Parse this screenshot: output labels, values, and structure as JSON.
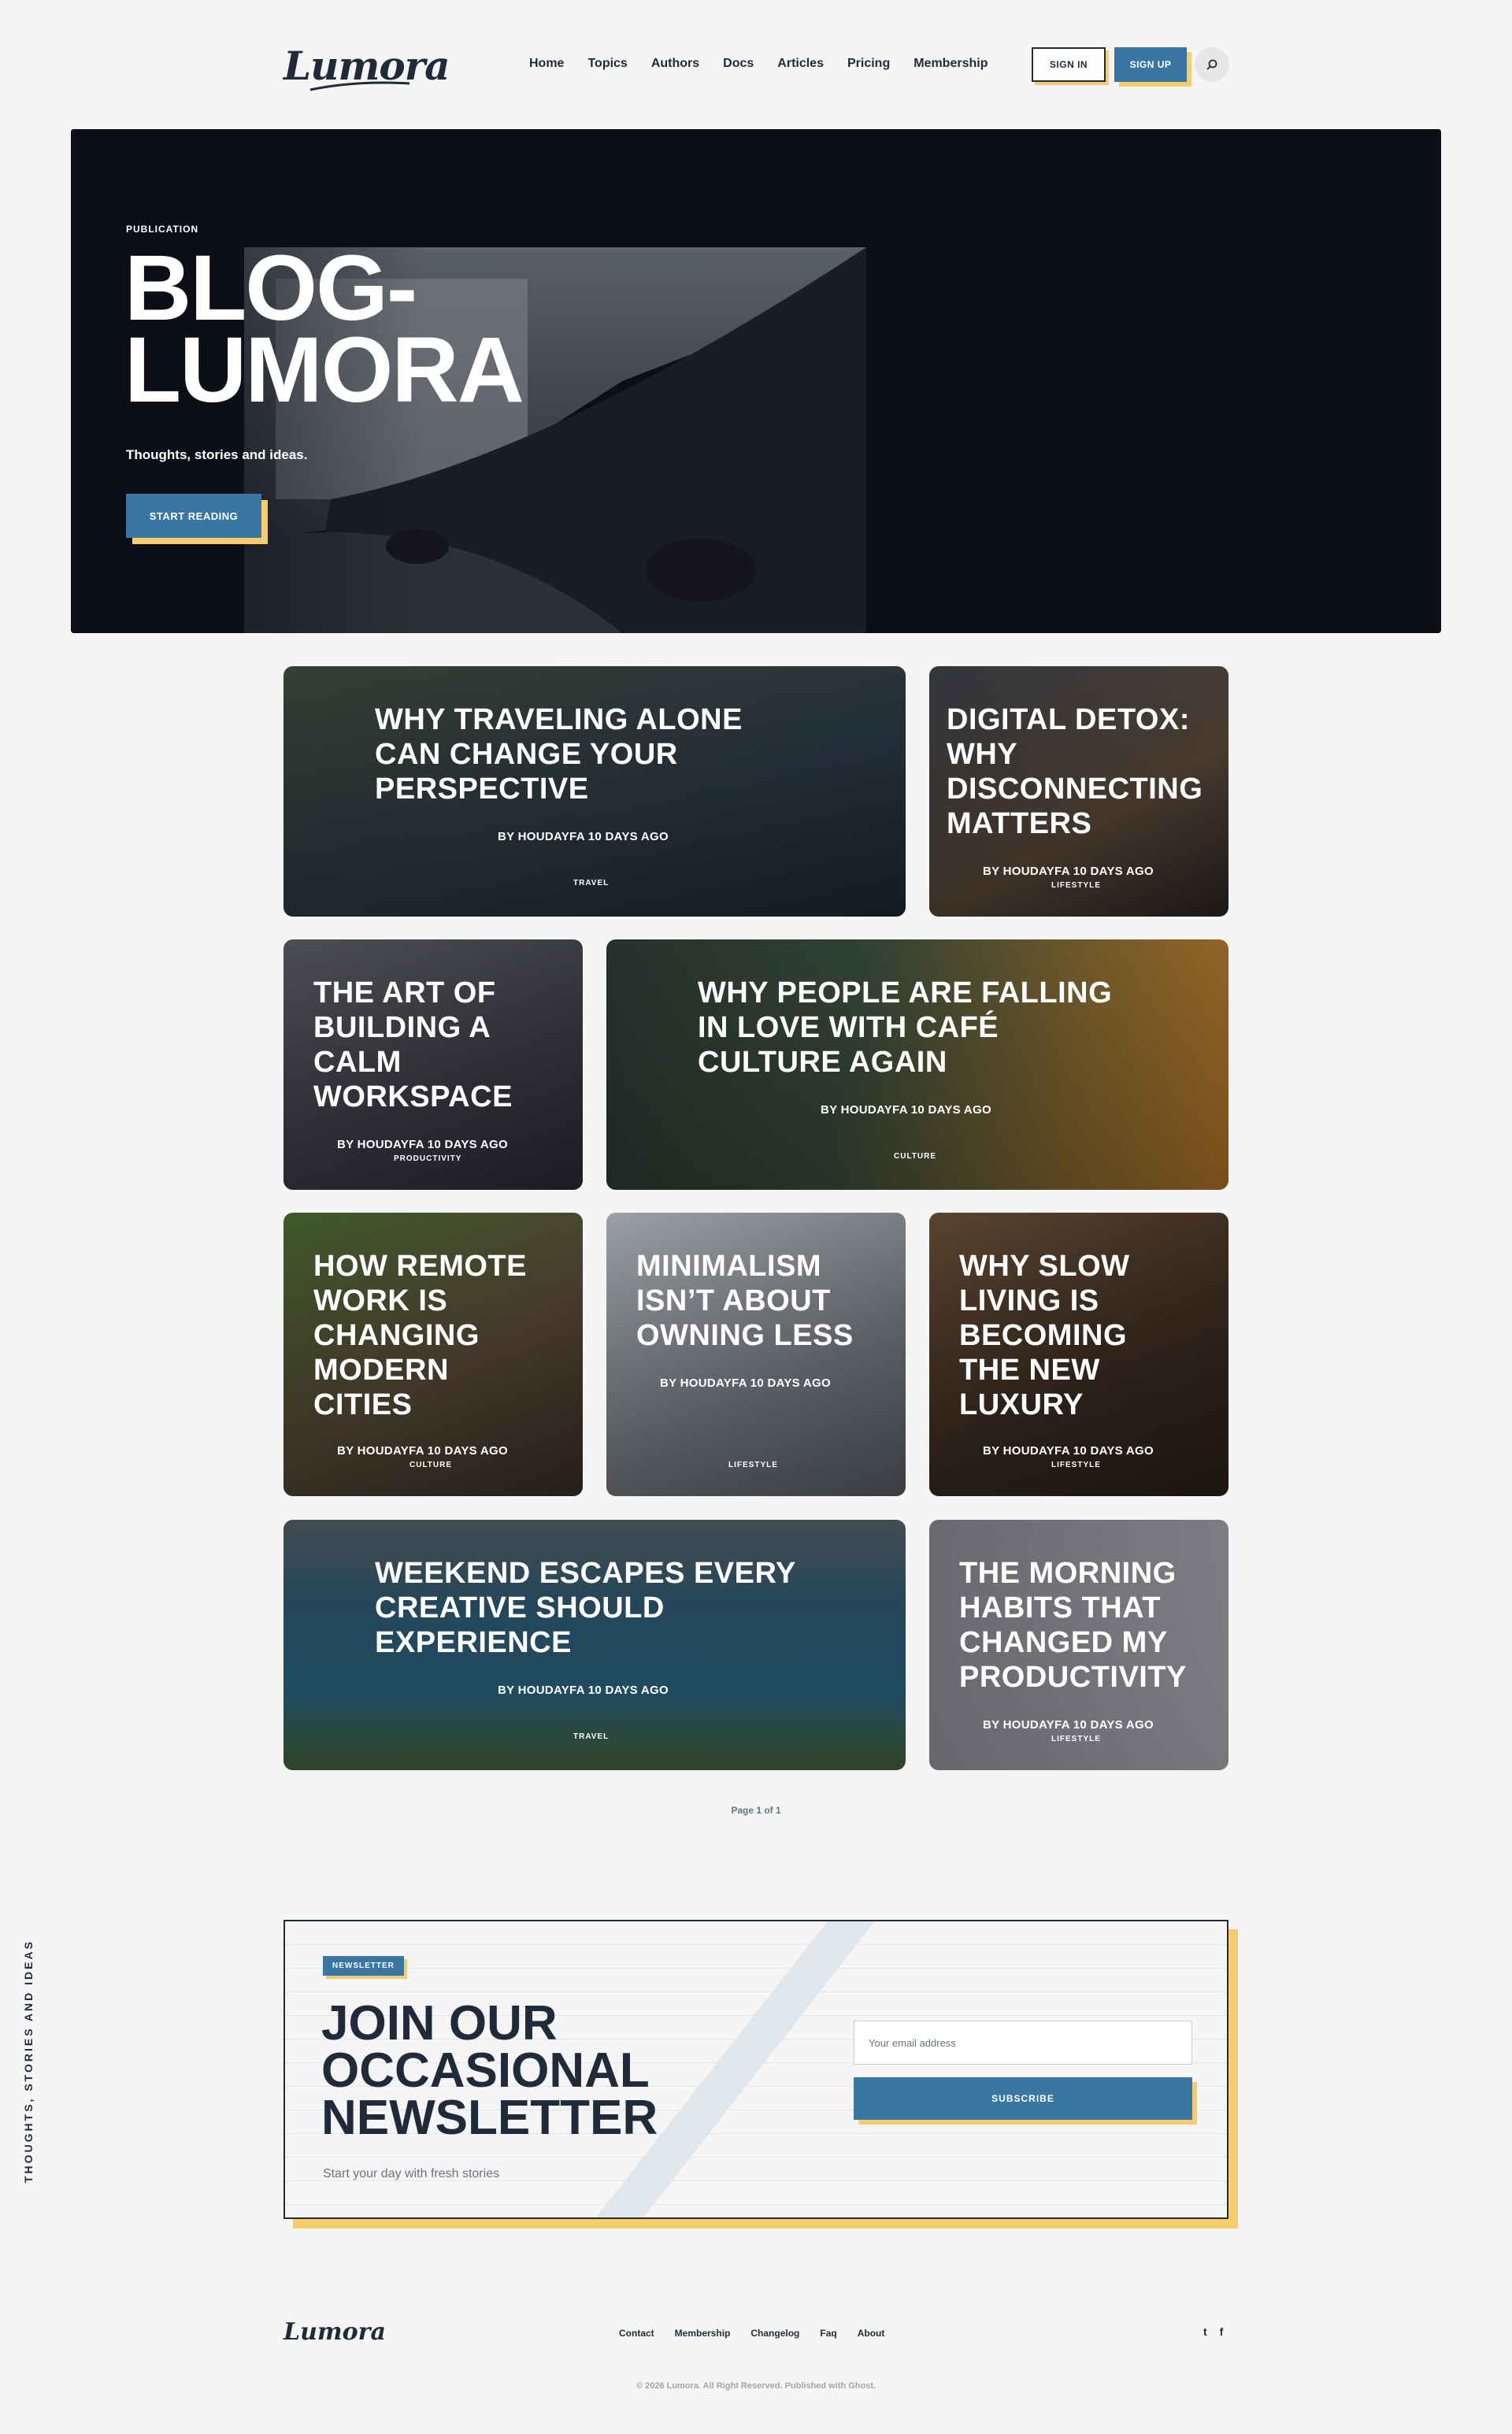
{
  "header": {
    "logo": "Lumora",
    "nav": [
      "Home",
      "Topics",
      "Authors",
      "Docs",
      "Articles",
      "Pricing",
      "Membership"
    ],
    "sign_in": "SIGN IN",
    "sign_up": "SIGN UP",
    "search_icon": "search-icon"
  },
  "hero": {
    "label": "PUBLICATION",
    "title": "BLOG-LUMORA",
    "subtitle": "Thoughts, stories and ideas.",
    "button": "START READING"
  },
  "posts": [
    {
      "title": "WHY TRAVELING ALONE CAN CHANGE YOUR PERSPECTIVE",
      "meta": "BY HOUDAYFA 10 DAYS AGO",
      "tag": "TRAVEL"
    },
    {
      "title": "DIGITAL DETOX: WHY DISCONNECTING MATTERS",
      "meta": "BY HOUDAYFA 10 DAYS AGO",
      "tag": "LIFESTYLE"
    },
    {
      "title": "THE ART OF BUILDING A CALM WORKSPACE",
      "meta": "BY HOUDAYFA 10 DAYS AGO",
      "tag": "PRODUCTIVITY"
    },
    {
      "title": "WHY PEOPLE ARE FALLING IN LOVE WITH CAFÉ CULTURE AGAIN",
      "meta": "BY HOUDAYFA 10 DAYS AGO",
      "tag": "CULTURE"
    },
    {
      "title": "HOW REMOTE WORK IS CHANGING MODERN CITIES",
      "meta": "BY HOUDAYFA 10 DAYS AGO",
      "tag": "CULTURE"
    },
    {
      "title": "MINIMALISM ISN’T ABOUT OWNING LESS",
      "meta": "BY HOUDAYFA 10 DAYS AGO",
      "tag": "LIFESTYLE"
    },
    {
      "title": "WHY SLOW LIVING IS BECOMING THE NEW LUXURY",
      "meta": "BY HOUDAYFA 10 DAYS AGO",
      "tag": "LIFESTYLE"
    },
    {
      "title": "WEEKEND ESCAPES EVERY CREATIVE SHOULD EXPERIENCE",
      "meta": "BY HOUDAYFA 10 DAYS AGO",
      "tag": "TRAVEL"
    },
    {
      "title": "THE MORNING HABITS THAT CHANGED MY PRODUCTIVITY",
      "meta": "BY HOUDAYFA 10 DAYS AGO",
      "tag": "LIFESTYLE"
    }
  ],
  "pagination": "Page 1 of 1",
  "side_text": "THOUGHTS, STORIES AND IDEAS",
  "newsletter": {
    "tag": "NEWSLETTER",
    "title": "JOIN OUR OCCASIONAL NEWSLETTER",
    "subtitle": "Start your day with fresh stories",
    "placeholder": "Your email address",
    "button": "SUBSCRIBE"
  },
  "footer": {
    "logo": "Lumora",
    "links": [
      "Contact",
      "Membership",
      "Changelog",
      "Faq",
      "About"
    ],
    "social": [
      "t",
      "f"
    ],
    "copyright": "© 2026 Lumora. All Right Reserved. Published with Ghost."
  },
  "colors": {
    "accent": "#3a76a2",
    "shadow": "#f7cc6d",
    "ink": "#1f2a3a"
  }
}
